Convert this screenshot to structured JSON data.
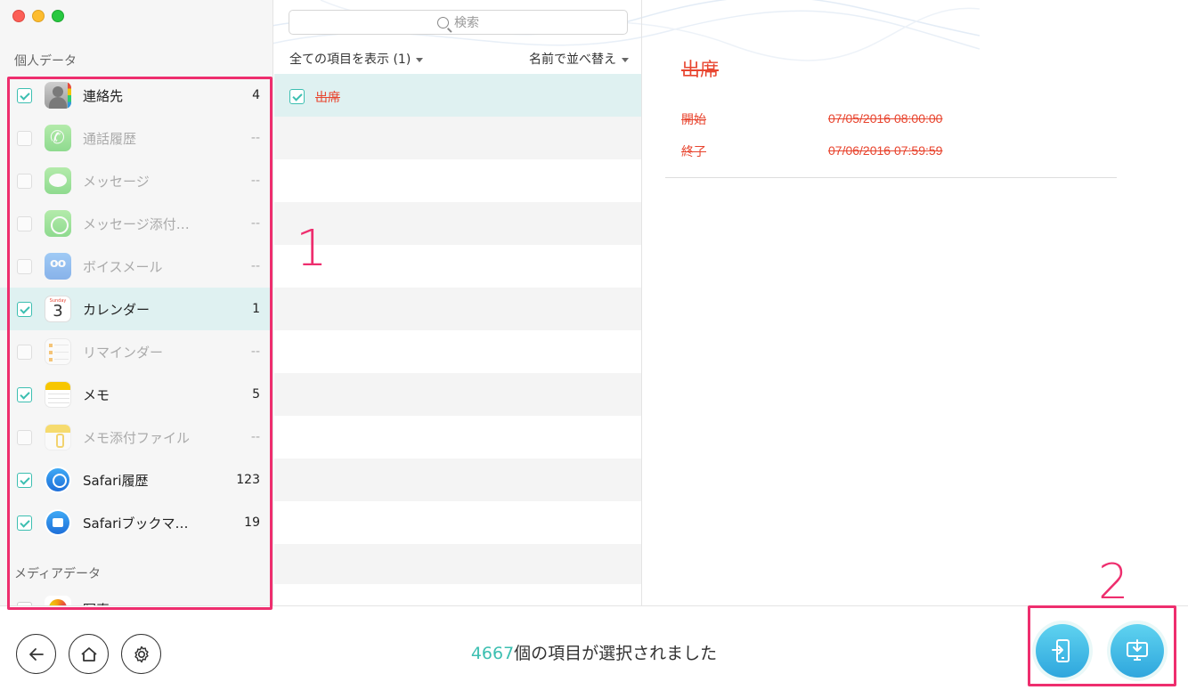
{
  "search": {
    "placeholder": "検索"
  },
  "sidebar": {
    "section_personal": "個人データ",
    "section_media": "メディアデータ",
    "items": [
      {
        "label": "連絡先",
        "count": "4",
        "checked": true,
        "icon": "contacts-icon"
      },
      {
        "label": "通話履歴",
        "count": "--",
        "checked": false,
        "icon": "phone-icon"
      },
      {
        "label": "メッセージ",
        "count": "--",
        "checked": false,
        "icon": "messages-icon"
      },
      {
        "label": "メッセージ添付…",
        "count": "--",
        "checked": false,
        "icon": "message-attachment-icon"
      },
      {
        "label": "ボイスメール",
        "count": "--",
        "checked": false,
        "icon": "voicemail-icon"
      },
      {
        "label": "カレンダー",
        "count": "1",
        "checked": true,
        "icon": "calendar-icon"
      },
      {
        "label": "リマインダー",
        "count": "--",
        "checked": false,
        "icon": "reminders-icon"
      },
      {
        "label": "メモ",
        "count": "5",
        "checked": true,
        "icon": "notes-icon"
      },
      {
        "label": "メモ添付ファイル",
        "count": "--",
        "checked": false,
        "icon": "notes-attachment-icon"
      },
      {
        "label": "Safari履歴",
        "count": "123",
        "checked": true,
        "icon": "safari-history-icon"
      },
      {
        "label": "Safariブックマ…",
        "count": "19",
        "checked": true,
        "icon": "safari-bookmark-icon"
      }
    ],
    "media_items": [
      {
        "label": "写真",
        "icon": "photos-icon"
      }
    ],
    "calendar_icon": {
      "weekday": "Sunday",
      "day": "3"
    }
  },
  "list": {
    "filter_label": "全ての項目を表示 (1)",
    "sort_label": "名前で並べ替え",
    "rows": [
      {
        "label": "出席",
        "checked": true
      }
    ]
  },
  "detail": {
    "title": "出席",
    "fields": [
      {
        "key": "開始",
        "value": "07/05/2016 08:00:00"
      },
      {
        "key": "終了",
        "value": "07/06/2016 07:59:59"
      }
    ]
  },
  "annotations": {
    "box1": "1",
    "box2": "2"
  },
  "footer": {
    "count": "4667",
    "status_suffix": "個の項目が選択されました"
  },
  "colors": {
    "accent": "#3cbfb1",
    "annotation": "#ee2e6e",
    "deleted": "#e8452f"
  }
}
